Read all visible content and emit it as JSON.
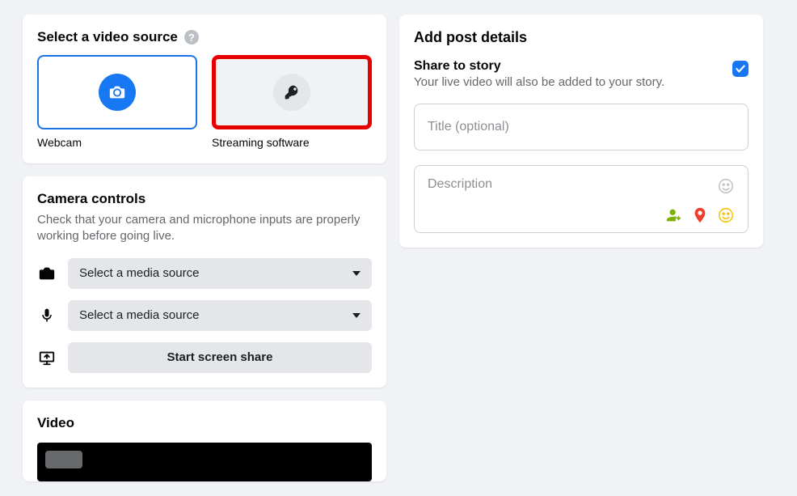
{
  "source": {
    "title": "Select a video source",
    "options": [
      {
        "label": "Webcam"
      },
      {
        "label": "Streaming software"
      }
    ]
  },
  "controls": {
    "title": "Camera controls",
    "subtitle": "Check that your camera and microphone inputs are properly working before going live.",
    "camera_select": "Select a media source",
    "mic_select": "Select a media source",
    "share_button": "Start screen share"
  },
  "video": {
    "title": "Video"
  },
  "post": {
    "title": "Add post details",
    "story_heading": "Share to story",
    "story_sub": "Your live video will also be added to your story.",
    "title_placeholder": "Title (optional)",
    "description_placeholder": "Description"
  }
}
